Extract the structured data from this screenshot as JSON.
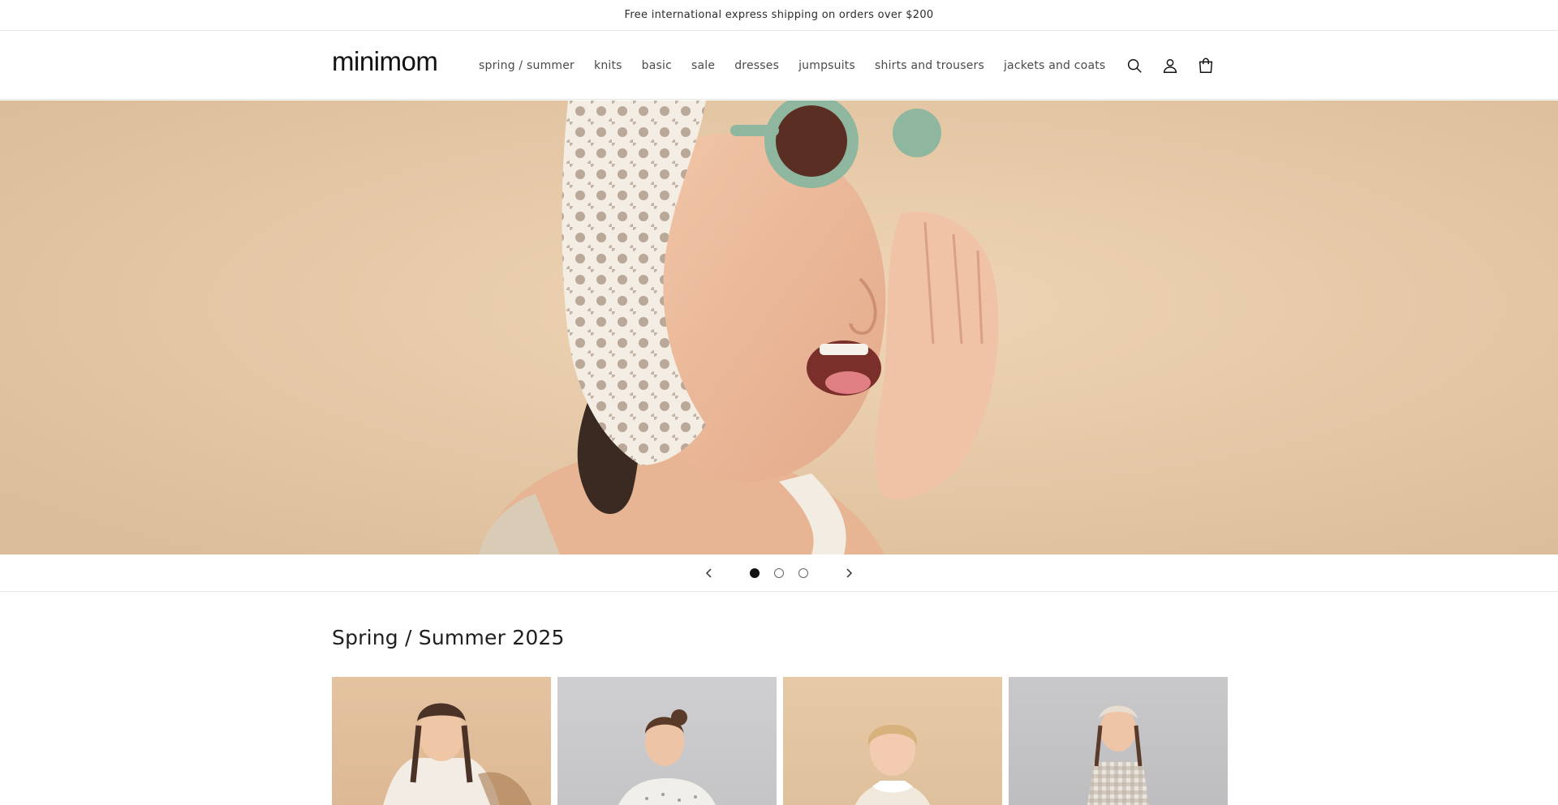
{
  "announcement": {
    "text": "Free international express shipping on orders over $200"
  },
  "header": {
    "logo": "minimom",
    "nav": [
      {
        "label": "spring / summer"
      },
      {
        "label": "knits"
      },
      {
        "label": "basic"
      },
      {
        "label": "sale"
      },
      {
        "label": "dresses"
      },
      {
        "label": "jumpsuits"
      },
      {
        "label": "shirts and trousers"
      },
      {
        "label": "jackets and coats"
      }
    ],
    "icons": [
      "search-icon",
      "account-icon",
      "cart-icon"
    ]
  },
  "hero": {
    "slides_count": 3,
    "active_slide": 1,
    "colors": {
      "background": "#e8caa8",
      "sunglasses": "#8fb7a0",
      "bonnet": "#f2ece2"
    }
  },
  "collection": {
    "title": "Spring / Summer 2025",
    "products": [
      {
        "image": "girl-braids-ruffle-dress"
      },
      {
        "image": "girl-polka-dot-dress"
      },
      {
        "image": "toddler-collar-dress"
      },
      {
        "image": "girl-gingham-dress"
      }
    ]
  }
}
